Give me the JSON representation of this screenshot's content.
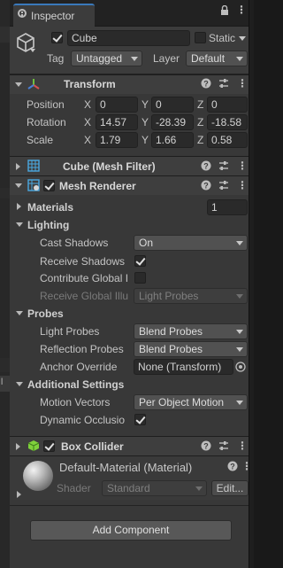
{
  "tab": {
    "title": "Inspector"
  },
  "left_strip": {
    "frag1": "",
    "frag2": "",
    "frag3": "",
    "frag4": "l"
  },
  "header": {
    "object_active": true,
    "object_name": "Cube",
    "static_label": "Static",
    "static_checked": false,
    "tag_label": "Tag",
    "tag_value": "Untagged",
    "layer_label": "Layer",
    "layer_value": "Default"
  },
  "transform": {
    "title": "Transform",
    "rows": [
      {
        "label": "Position",
        "x": "0",
        "y": "0",
        "z": "0"
      },
      {
        "label": "Rotation",
        "x": "14.57",
        "y": "-28.39",
        "z": "-18.58"
      },
      {
        "label": "Scale",
        "x": "1.79",
        "y": "1.66",
        "z": "0.58"
      }
    ],
    "axis": {
      "x": "X",
      "y": "Y",
      "z": "Z"
    }
  },
  "mesh_filter": {
    "title": "Cube (Mesh Filter)"
  },
  "mesh_renderer": {
    "title": "Mesh Renderer",
    "enabled": true,
    "materials_label": "Materials",
    "materials_count": "1",
    "lighting_label": "Lighting",
    "cast_shadows_label": "Cast Shadows",
    "cast_shadows_value": "On",
    "receive_shadows_label": "Receive Shadows",
    "receive_shadows_checked": true,
    "contribute_gi_label": "Contribute Global I",
    "contribute_gi_checked": false,
    "receive_gi_label": "Receive Global Illu",
    "receive_gi_value": "Light Probes",
    "probes_label": "Probes",
    "light_probes_label": "Light Probes",
    "light_probes_value": "Blend Probes",
    "reflection_probes_label": "Reflection Probes",
    "reflection_probes_value": "Blend Probes",
    "anchor_override_label": "Anchor Override",
    "anchor_override_value": "None (Transform)",
    "additional_label": "Additional Settings",
    "motion_vectors_label": "Motion Vectors",
    "motion_vectors_value": "Per Object Motion",
    "dynamic_occlusion_label": "Dynamic Occlusio",
    "dynamic_occlusion_checked": true
  },
  "box_collider": {
    "title": "Box Collider",
    "enabled": true
  },
  "material": {
    "name": "Default-Material (Material)",
    "shader_label": "Shader",
    "shader_value": "Standard",
    "edit_label": "Edit..."
  },
  "add_component_label": "Add Component",
  "colors": {
    "panel_bg": "#383838",
    "header_bg": "#3e3e3e",
    "field_bg": "#2a2a2a",
    "tab_accent": "#3a79bb",
    "transform_icon_red": "#d65050",
    "transform_icon_green": "#6fbf3f",
    "transform_icon_blue": "#4a7fd6",
    "collider_icon_green": "#7fd13b"
  }
}
